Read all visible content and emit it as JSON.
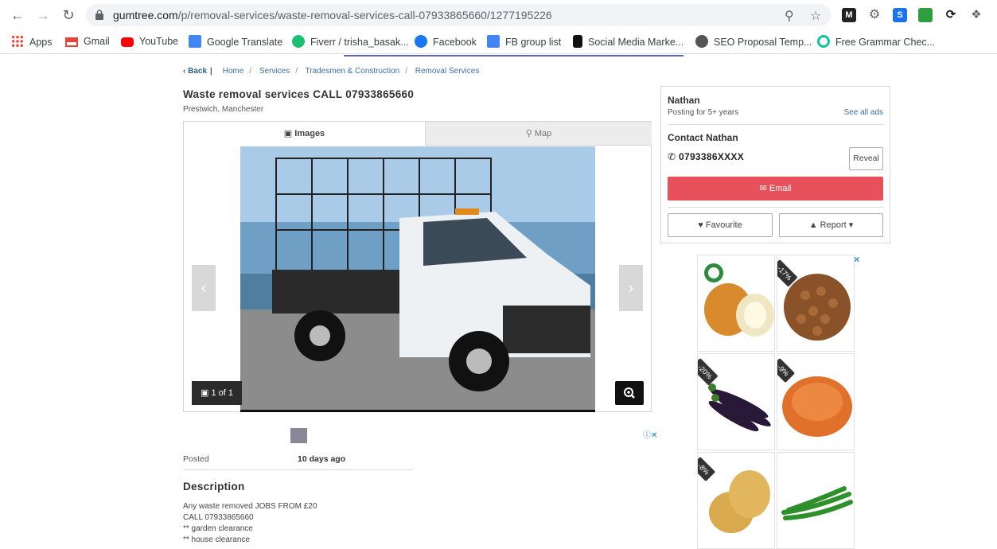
{
  "browser": {
    "url_host": "gumtree.com",
    "url_path": "/p/removal-services/waste-removal-services-call-07933865660/1277195226",
    "bookmarks": [
      "Apps",
      "Gmail",
      "YouTube",
      "Google Translate",
      "Fiverr / trisha_basak...",
      "Facebook",
      "FB group list",
      "Social Media Marke...",
      "SEO Proposal Temp...",
      "Free Grammar Chec..."
    ],
    "extensions": [
      "M",
      "S"
    ]
  },
  "breadcrumb": {
    "back": "Back",
    "items": [
      "Home",
      "Services",
      "Tradesmen & Construction",
      "Removal Services"
    ]
  },
  "listing": {
    "title": "Waste removal services CALL 07933865660",
    "location": "Prestwich, Manchester",
    "tabs": {
      "images": "Images",
      "map": "Map"
    },
    "photo_counter": "1 of 1",
    "posted_label": "Posted",
    "posted_value": "10 days ago",
    "description_heading": "Description",
    "description_lines": [
      "Any waste removed JOBS FROM £20",
      "CALL 07933865660",
      "** garden clearance",
      "** house clearance"
    ]
  },
  "seller": {
    "name": "Nathan",
    "posting_for": "Posting for 5+ years",
    "see_all": "See all ads",
    "contact_heading": "Contact Nathan",
    "phone": "0793386XXXX",
    "reveal": "Reveal",
    "email": "Email",
    "favourite": "Favourite",
    "report": "Report"
  },
  "ads": {
    "discounts": [
      "-17%",
      "-20%",
      "-9%",
      "-8%"
    ]
  },
  "colors": {
    "accent_red": "#e8505b",
    "link_blue": "#3c6fa0"
  }
}
